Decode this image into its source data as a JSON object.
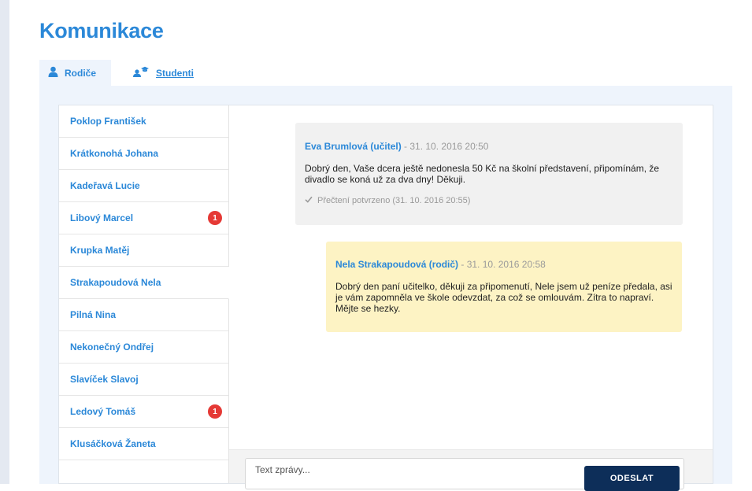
{
  "page": {
    "title": "Komunikace"
  },
  "tabs": [
    {
      "label": "Rodiče",
      "icon": "parent-icon",
      "active": true
    },
    {
      "label": "Studenti",
      "icon": "student-icon",
      "active": false
    }
  ],
  "contacts": [
    {
      "name": "Poklop František",
      "unread": null
    },
    {
      "name": "Krátkonohá Johana",
      "unread": null
    },
    {
      "name": "Kadeřavá Lucie",
      "unread": null
    },
    {
      "name": "Libový Marcel",
      "unread": "1"
    },
    {
      "name": "Krupka Matěj",
      "unread": null
    },
    {
      "name": "Strakapoudová Nela",
      "unread": null,
      "active": true
    },
    {
      "name": "Pilná Nina",
      "unread": null
    },
    {
      "name": "Nekonečný Ondřej",
      "unread": null
    },
    {
      "name": "Slavíček Slavoj",
      "unread": null
    },
    {
      "name": "Ledový Tomáš",
      "unread": "1"
    },
    {
      "name": "Klusáčková Žaneta",
      "unread": null
    }
  ],
  "messages": [
    {
      "author": "Eva Brumlová (učitel)",
      "date": " - 31. 10. 2016 20:50",
      "body": "Dobrý den, Vaše dcera ještě nedonesla 50 Kč na školní představení, připomínám, že divadlo se koná už za dva dny! Děkuji.",
      "receipt": "Přečtení potvrzeno (31. 10. 2016 20:55)"
    },
    {
      "author": "Nela Strakapoudová (rodič)",
      "date": " - 31. 10. 2016 20:58",
      "body": "Dobrý den paní učitelko, děkuji za připomenutí, Nele jsem už peníze předala, asi je vám zapomněla ve škole odevzdat, za což se omlouvám. Zítra to napraví. Mějte se hezky."
    }
  ],
  "composer": {
    "placeholder": "Text zprávy...",
    "send_label": "ODESLAT"
  },
  "colors": {
    "accent": "#2b88d8",
    "send_button": "#0d2e59",
    "badge": "#e53935",
    "teacher_bubble": "#f1f1f1",
    "parent_bubble": "#fdf3c4",
    "panel": "#eef4fc"
  }
}
